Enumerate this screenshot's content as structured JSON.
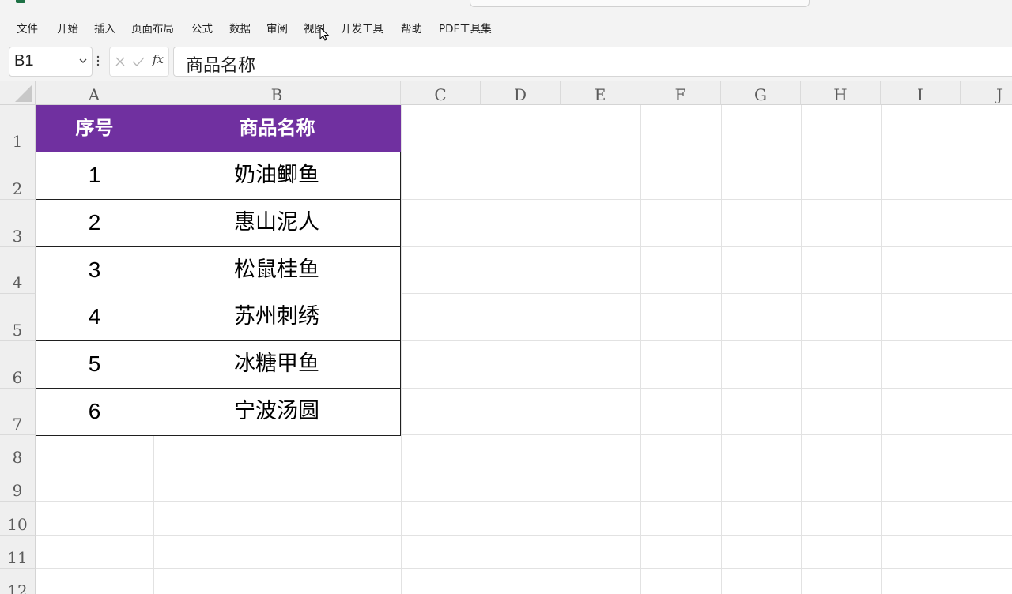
{
  "ribbon": {
    "tabs": [
      "文件",
      "开始",
      "插入",
      "页面布局",
      "公式",
      "数据",
      "审阅",
      "视图",
      "开发工具",
      "帮助",
      "PDF工具集"
    ]
  },
  "formula_bar": {
    "name_box": "B1",
    "cancel_icon": "x-icon",
    "enter_icon": "check-icon",
    "fx_label": "fx",
    "formula_value": "商品名称"
  },
  "sheet": {
    "columns": [
      "A",
      "B",
      "C",
      "D",
      "E",
      "F",
      "G",
      "H",
      "I",
      "J"
    ],
    "rows": [
      "1",
      "2",
      "3",
      "4",
      "5",
      "6",
      "7",
      "8",
      "9",
      "10",
      "11",
      "12"
    ],
    "table": {
      "headers": [
        "序号",
        "商品名称"
      ],
      "header_color": "#7030a0",
      "rows": [
        [
          "1",
          "奶油鲫鱼"
        ],
        [
          "2",
          "惠山泥人"
        ],
        [
          "3",
          "松鼠桂鱼"
        ],
        [
          "4",
          "苏州刺绣"
        ],
        [
          "5",
          "冰糖甲鱼"
        ],
        [
          "6",
          "宁波汤圆"
        ]
      ]
    }
  }
}
